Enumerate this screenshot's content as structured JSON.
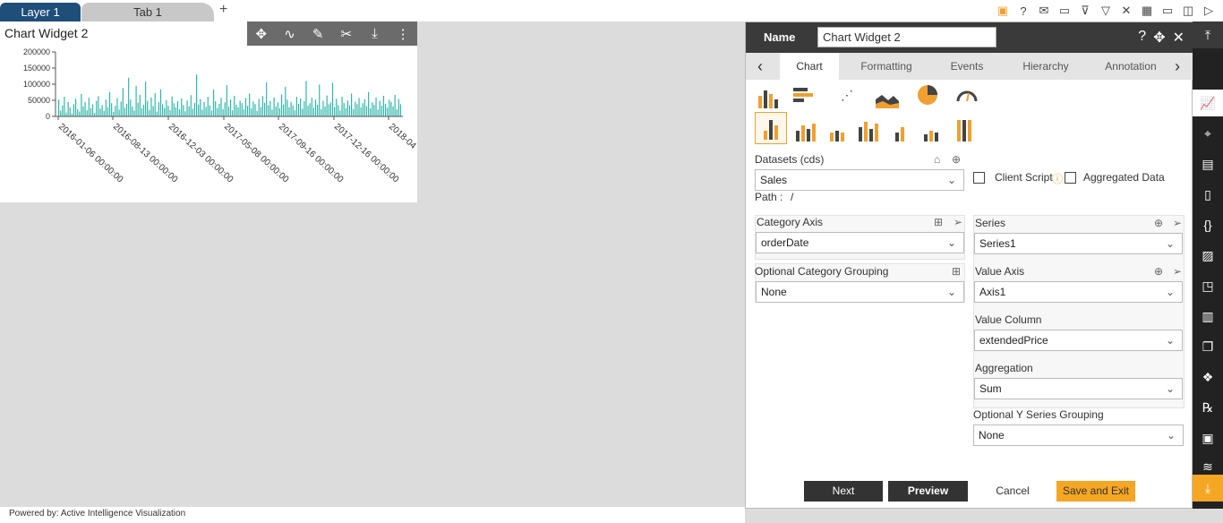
{
  "tabs": {
    "layer": "Layer 1",
    "tab1": "Tab 1",
    "add": "+"
  },
  "top_icons": [
    "save-icon",
    "help-icon",
    "mail-icon",
    "comment-icon",
    "filter-clear-icon",
    "filter-icon",
    "tools-icon",
    "table-icon",
    "monitor-icon",
    "devices-icon",
    "play-icon"
  ],
  "widget": {
    "title": "Chart Widget 2",
    "toolbar_icons": [
      "move-icon",
      "link-icon",
      "edit-icon",
      "tools-icon",
      "download-icon",
      "more-icon"
    ]
  },
  "chart_data": {
    "type": "bar",
    "color": "#2bb5a8",
    "ylim": [
      0,
      200000
    ],
    "y_ticks": [
      "200000",
      "150000",
      "100000",
      "50000",
      "0"
    ],
    "x_ticks": [
      "2016-01-06 00:00:00",
      "2016-08-13 00:00:00",
      "2016-12-03 00:00:00",
      "2017-05-08 00:00:00",
      "2017-09-16 00:00:00",
      "2017-12-16 00:00:00",
      "2018-04"
    ],
    "values": [
      52000,
      18000,
      34000,
      61000,
      12000,
      45000,
      28000,
      9000,
      38000,
      55000,
      22000,
      15000,
      70000,
      31000,
      44000,
      19000,
      58000,
      26000,
      37000,
      11000,
      48000,
      63000,
      24000,
      35000,
      17000,
      52000,
      29000,
      76000,
      41000,
      14000,
      33000,
      57000,
      21000,
      46000,
      88000,
      27000,
      39000,
      120000,
      52000,
      31000,
      18000,
      95000,
      43000,
      67000,
      25000,
      36000,
      108000,
      48000,
      20000,
      59000,
      32000,
      72000,
      15000,
      44000,
      84000,
      38000,
      26000,
      51000,
      33000,
      19000,
      62000,
      41000,
      28000,
      47000,
      22000,
      56000,
      35000,
      16000,
      49000,
      31000,
      66000,
      24000,
      42000,
      130000,
      37000,
      54000,
      21000,
      45000,
      29000,
      61000,
      34000,
      18000,
      83000,
      47000,
      26000,
      39000,
      58000,
      23000,
      44000,
      97000,
      31000,
      52000,
      19000,
      64000,
      36000,
      28000,
      49000,
      41000,
      22000,
      57000,
      33000,
      71000,
      25000,
      46000,
      38000,
      17000,
      54000,
      29000,
      63000,
      42000,
      106000,
      35000,
      48000,
      21000,
      59000,
      31000,
      44000,
      26000,
      68000,
      37000,
      92000,
      52000,
      28000,
      45000,
      34000,
      19000,
      61000,
      39000,
      56000,
      24000,
      47000,
      110000,
      33000,
      41000,
      58000,
      27000,
      52000,
      36000,
      99000,
      22000,
      48000,
      31000,
      65000,
      38000,
      43000,
      104000,
      29000,
      55000,
      35000,
      18000,
      61000,
      42000,
      26000,
      49000,
      34000,
      71000,
      23000,
      46000,
      38000,
      57000,
      28000,
      41000,
      53000,
      32000,
      76000,
      25000,
      44000,
      36000,
      59000,
      21000,
      48000,
      33000,
      64000,
      39000,
      27000,
      52000,
      45000,
      31000,
      67000,
      22000,
      54000,
      38000
    ]
  },
  "panel": {
    "name_label": "Name",
    "name_value": "Chart Widget 2",
    "tabs": [
      "Chart",
      "Formatting",
      "Events",
      "Hierarchy",
      "Annotation"
    ],
    "datasets_label": "Datasets (cds)",
    "datasets_value": "Sales",
    "path_label": "Path :",
    "path_value": "/",
    "client_script": "Client Script",
    "aggregated_data": "Aggregated Data",
    "category_axis_label": "Category Axis",
    "category_axis_value": "orderDate",
    "optional_category_label": "Optional Category Grouping",
    "optional_category_value": "None",
    "series_label": "Series",
    "series_value": "Series1",
    "value_axis_label": "Value Axis",
    "value_axis_value": "Axis1",
    "value_column_label": "Value Column",
    "value_column_value": "extendedPrice",
    "aggregation_label": "Aggregation",
    "aggregation_value": "Sum",
    "optional_y_label": "Optional Y Series Grouping",
    "optional_y_value": "None",
    "buttons": {
      "next": "Next",
      "preview": "Preview",
      "cancel": "Cancel",
      "save": "Save and Exit"
    }
  },
  "sidebar_icons": [
    "collapse-up-icon",
    "chart-icon",
    "map-icon",
    "report-icon",
    "document-icon",
    "code-icon",
    "image-icon",
    "form-icon",
    "kpi-icon",
    "copy-icon",
    "cubes-icon",
    "rx-icon",
    "clipboard-icon",
    "layers-icon",
    "download-icon"
  ],
  "footer": "Powered by: Active Intelligence Visualization",
  "colors": {
    "accent": "#f5a623",
    "header": "#1f4e79",
    "dark": "#333333"
  }
}
